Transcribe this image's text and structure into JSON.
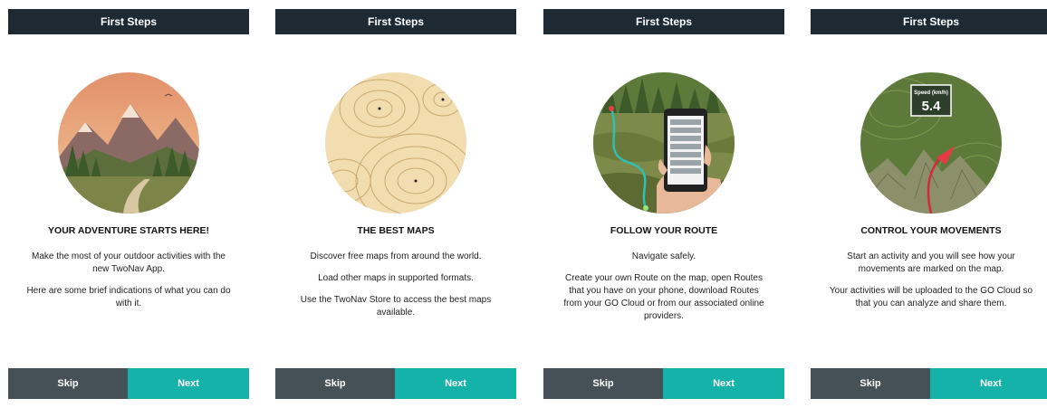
{
  "screens": [
    {
      "title": "First Steps",
      "heading": "YOUR ADVENTURE STARTS HERE!",
      "paragraphs": [
        "Make the most of your outdoor activities with the new TwoNav App.",
        "Here are some brief indications of what you can do with it."
      ],
      "illustration": "mountain-sunset-illustration",
      "skip_label": "Skip",
      "next_label": "Next"
    },
    {
      "title": "First Steps",
      "heading": "THE BEST MAPS",
      "paragraphs": [
        "Discover free maps from around the world.",
        "Load other maps in supported formats.",
        "Use the TwoNav Store to access the best maps available."
      ],
      "illustration": "topographic-map-illustration",
      "skip_label": "Skip",
      "next_label": "Next"
    },
    {
      "title": "First Steps",
      "heading": "FOLLOW YOUR ROUTE",
      "paragraphs": [
        "Navigate safely.",
        "Create your own Route on the map, open Routes that you have on your phone, download Routes from your GO Cloud or from our associated online providers."
      ],
      "illustration": "phone-route-illustration",
      "skip_label": "Skip",
      "next_label": "Next"
    },
    {
      "title": "First Steps",
      "heading": "CONTROL YOUR MOVEMENTS",
      "paragraphs": [
        "Start an activity and you will see how your movements are marked on the map.",
        "Your activities will be uploaded to the GO Cloud so that you can analyze and share them."
      ],
      "illustration": "speed-tracking-illustration",
      "speed_label": "Speed (km/h)",
      "speed_value": "5.4",
      "skip_label": "Skip",
      "next_label": "Next"
    }
  ],
  "colors": {
    "topbar": "#1d2a33",
    "skip": "#465157",
    "next": "#14b2a9"
  }
}
